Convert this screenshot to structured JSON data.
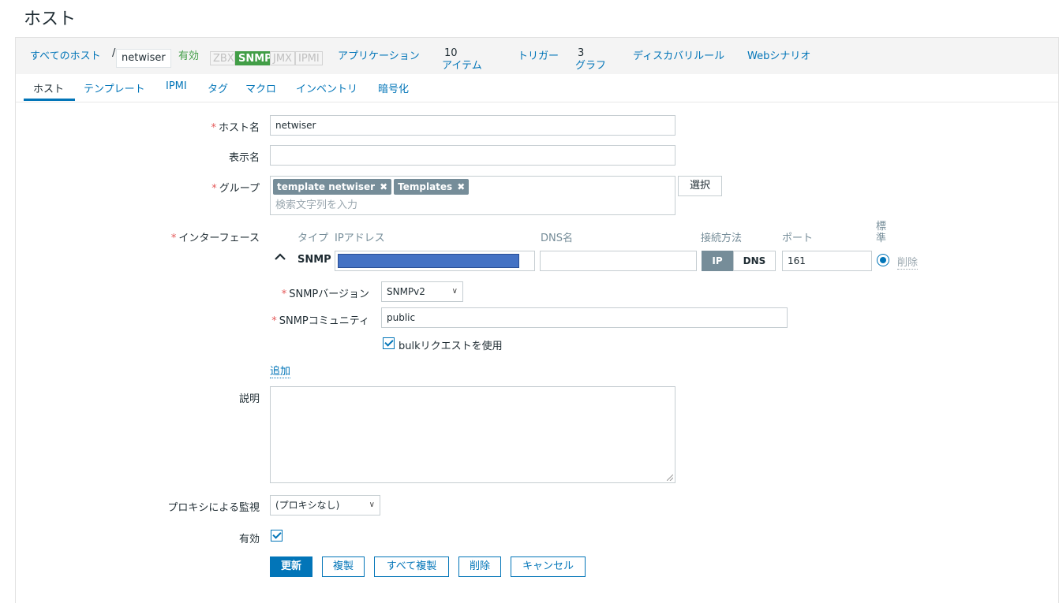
{
  "page_title": "ホスト",
  "breadcrumb": {
    "all_hosts": "すべてのホスト",
    "separator": "/",
    "current": "netwiser",
    "status": "有効",
    "availability": [
      "ZBX",
      "SNMP",
      "JMX",
      "IPMI"
    ],
    "links": {
      "applications": "アプリケーション",
      "items": "アイテム",
      "items_count": "10",
      "triggers": "トリガー",
      "graphs": "グラフ",
      "graphs_count": "3",
      "discovery": "ディスカバリルール",
      "web": "Webシナリオ"
    }
  },
  "tabs": [
    "ホスト",
    "テンプレート",
    "IPMI",
    "タグ",
    "マクロ",
    "インベントリ",
    "暗号化"
  ],
  "form": {
    "required_mark": "*",
    "hostname_label": "ホスト名",
    "hostname_value": "netwiser",
    "visible_name_label": "表示名",
    "visible_name_value": "",
    "groups_label": "グループ",
    "groups": [
      "template netwiser",
      "Templates"
    ],
    "groups_placeholder": "検索文字列を入力",
    "select_button": "選択",
    "interfaces_label": "インターフェース",
    "interface_headers": {
      "type": "タイプ",
      "ip": "IPアドレス",
      "dns": "DNS名",
      "connect": "接続方法",
      "port": "ポート",
      "default": "標準"
    },
    "interface": {
      "type": "SNMP",
      "ip": "",
      "dns": "",
      "connect_ip": "IP",
      "connect_dns": "DNS",
      "port": "161",
      "remove": "削除"
    },
    "snmp_version_label": "SNMPバージョン",
    "snmp_version_value": "SNMPv2",
    "snmp_community_label": "SNMPコミュニティ",
    "snmp_community_value": "public",
    "bulk_label": "bulkリクエストを使用",
    "add_link": "追加",
    "description_label": "説明",
    "proxy_label": "プロキシによる監視",
    "proxy_value": "(プロキシなし)",
    "enabled_label": "有効"
  },
  "buttons": {
    "update": "更新",
    "clone": "複製",
    "full_clone": "すべて複製",
    "delete": "削除",
    "cancel": "キャンセル"
  },
  "colors": {
    "link": "#0275b8",
    "enabled": "#429e47",
    "required": "#e45959",
    "masked_ip": "#4472c4"
  }
}
